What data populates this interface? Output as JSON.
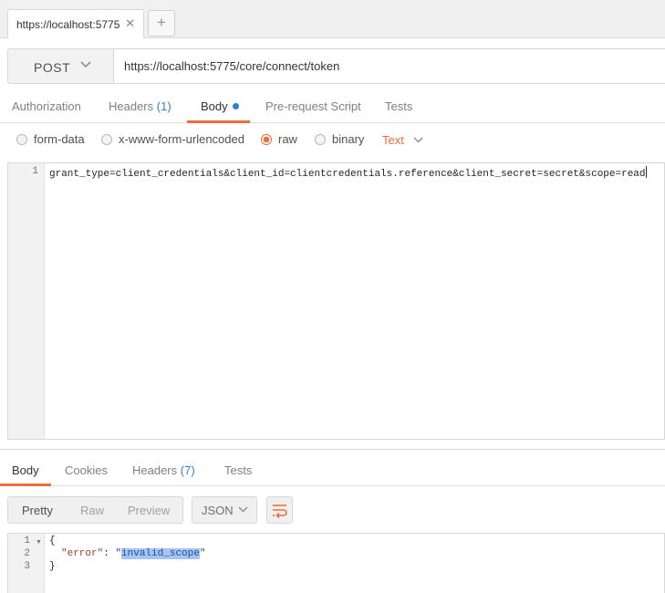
{
  "tabbar": {
    "tab_title": "https://localhost:5775",
    "close_glyph": "✕",
    "new_tab_glyph": "+"
  },
  "request": {
    "method": "POST",
    "url": "https://localhost:5775/core/connect/token"
  },
  "request_tabs": {
    "authorization": "Authorization",
    "headers_label": "Headers",
    "headers_count": "(1)",
    "body": "Body",
    "prerequest": "Pre-request Script",
    "tests": "Tests"
  },
  "body_types": {
    "form_data": "form-data",
    "urlencoded": "x-www-form-urlencoded",
    "raw": "raw",
    "binary": "binary",
    "selected": "raw",
    "format": "Text"
  },
  "editor": {
    "line_numbers": [
      "1"
    ],
    "lines": [
      "grant_type=client_credentials&client_id=clientcredentials.reference&client_secret=secret&scope=read"
    ]
  },
  "response_tabs": {
    "body": "Body",
    "cookies": "Cookies",
    "headers_label": "Headers",
    "headers_count": "(7)",
    "tests": "Tests"
  },
  "response_view": {
    "pretty": "Pretty",
    "raw": "Raw",
    "preview": "Preview",
    "format": "JSON"
  },
  "response_body": {
    "line_numbers": [
      "1",
      "2",
      "3"
    ],
    "open_brace": "{",
    "key": "\"error\"",
    "colon": ": ",
    "quote": "\"",
    "value": "invalid_scope",
    "close_brace": "}"
  },
  "colors": {
    "accent": "#f26b3a",
    "link_blue": "#2e83c8",
    "selection": "#a8c4f0"
  },
  "icons": [
    "close-icon",
    "plus-icon",
    "chevron-down-icon",
    "wrap-lines-icon",
    "fold-arrow-icon"
  ]
}
